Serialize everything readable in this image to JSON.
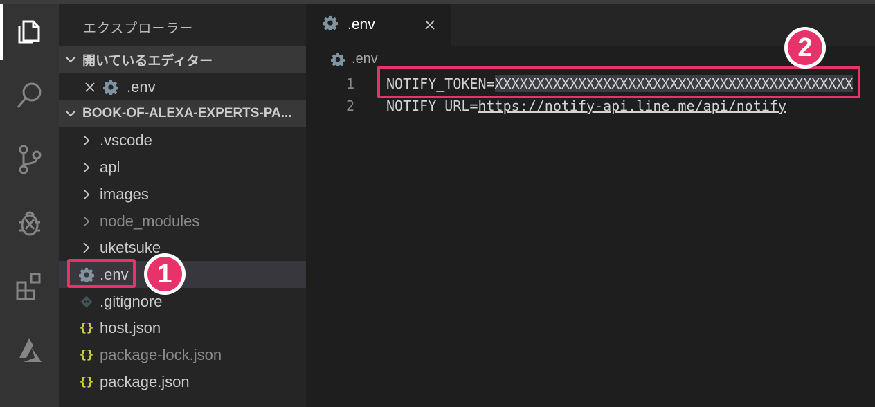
{
  "sidebar": {
    "title": "エクスプローラー",
    "open_editors": {
      "header": "開いているエディター",
      "items": [
        {
          "label": ".env"
        }
      ]
    },
    "project": {
      "header": "BOOK-OF-ALEXA-EXPERTS-PA...",
      "items": [
        {
          "label": ".vscode",
          "type": "folder",
          "icon": "chevron-right-icon"
        },
        {
          "label": "apl",
          "type": "folder",
          "icon": "chevron-right-icon"
        },
        {
          "label": "images",
          "type": "folder",
          "icon": "chevron-right-icon"
        },
        {
          "label": "node_modules",
          "type": "folder",
          "icon": "chevron-right-icon",
          "dimmed": true
        },
        {
          "label": "uketsuke",
          "type": "folder",
          "icon": "chevron-right-icon"
        },
        {
          "label": ".env",
          "type": "file",
          "icon": "gear-icon",
          "selected": true
        },
        {
          "label": ".gitignore",
          "type": "file",
          "icon": "git-icon"
        },
        {
          "label": "host.json",
          "type": "file",
          "icon": "json-icon",
          "icon_text": "{}"
        },
        {
          "label": "package-lock.json",
          "type": "file",
          "icon": "json-icon",
          "icon_text": "{}",
          "dimmed": true
        },
        {
          "label": "package.json",
          "type": "file",
          "icon": "json-icon",
          "icon_text": "{}"
        }
      ]
    }
  },
  "editor": {
    "tab": {
      "label": ".env"
    },
    "breadcrumb": ".env",
    "lines": [
      {
        "number": "1",
        "key": "NOTIFY_TOKEN=",
        "value": "XXXXXXXXXXXXXXXXXXXXXXXXXXXXXXXXXXXXXXXXXXX"
      },
      {
        "number": "2",
        "key": "NOTIFY_URL=",
        "value": "https://notify-api.line.me/api/notify"
      }
    ]
  },
  "annotations": {
    "badge1": "1",
    "badge2": "2"
  },
  "colors": {
    "highlight": "#e8336a",
    "json_icon": "#cbcb41",
    "gear_icon": "#7f93a0",
    "activity_bar": "#333333",
    "sidebar": "#252526",
    "editor": "#1e1e1e"
  }
}
